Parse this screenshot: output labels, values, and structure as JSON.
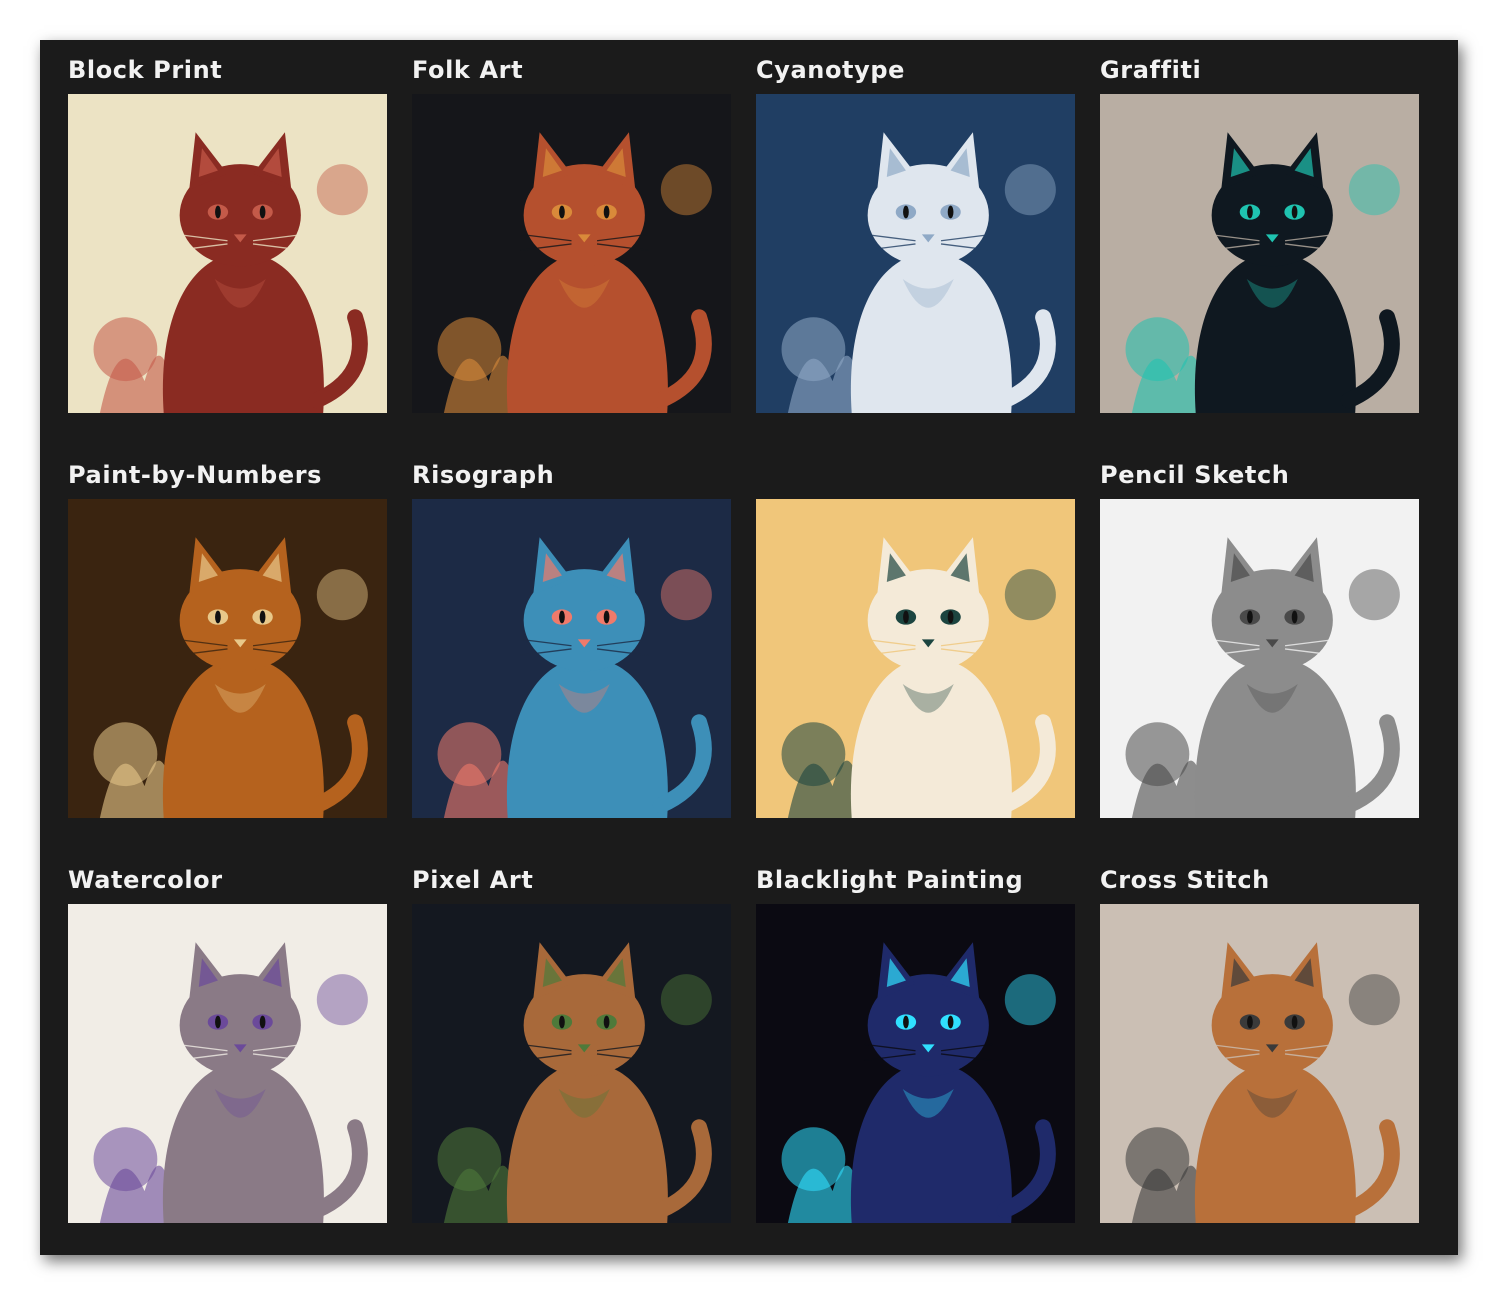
{
  "tiles": [
    {
      "label": "Block Print",
      "icon": "cat-illustration",
      "bg": "#ece3c4",
      "fg": "#8a2b22",
      "accent": "#c45a49"
    },
    {
      "label": "Folk Art",
      "icon": "cat-illustration",
      "bg": "#15161a",
      "fg": "#b5502e",
      "accent": "#d98a3a"
    },
    {
      "label": "Cyanotype",
      "icon": "cat-illustration",
      "bg": "#203e63",
      "fg": "#dfe6ee",
      "accent": "#8fa9c6"
    },
    {
      "label": "Graffiti",
      "icon": "cat-illustration",
      "bg": "#b9aea3",
      "fg": "#0f1820",
      "accent": "#1fc3b0"
    },
    {
      "label": "Paint-by-Numbers",
      "icon": "cat-illustration",
      "bg": "#3a2410",
      "fg": "#b5621e",
      "accent": "#e8c88a"
    },
    {
      "label": "Risograph",
      "icon": "cat-illustration",
      "bg": "#1c2a45",
      "fg": "#3d8fb8",
      "accent": "#f07a6a"
    },
    {
      "label": "",
      "icon": "cat-illustration",
      "bg": "#f0c67a",
      "fg": "#f4ead8",
      "accent": "#1c4540"
    },
    {
      "label": "Pencil Sketch",
      "icon": "cat-illustration",
      "bg": "#f2f2f2",
      "fg": "#8c8c8c",
      "accent": "#4a4a4a"
    },
    {
      "label": "Watercolor",
      "icon": "cat-illustration",
      "bg": "#f1ede6",
      "fg": "#8a7a86",
      "accent": "#6b4a9a"
    },
    {
      "label": "Pixel Art",
      "icon": "cat-illustration",
      "bg": "#141820",
      "fg": "#a8693a",
      "accent": "#4e7a3a"
    },
    {
      "label": "Blacklight Painting",
      "icon": "cat-illustration",
      "bg": "#0b0a12",
      "fg": "#1f2a6a",
      "accent": "#30e0ff"
    },
    {
      "label": "Cross Stitch",
      "icon": "cat-illustration",
      "bg": "#cbbfb4",
      "fg": "#b8703a",
      "accent": "#3a3a3a"
    }
  ]
}
